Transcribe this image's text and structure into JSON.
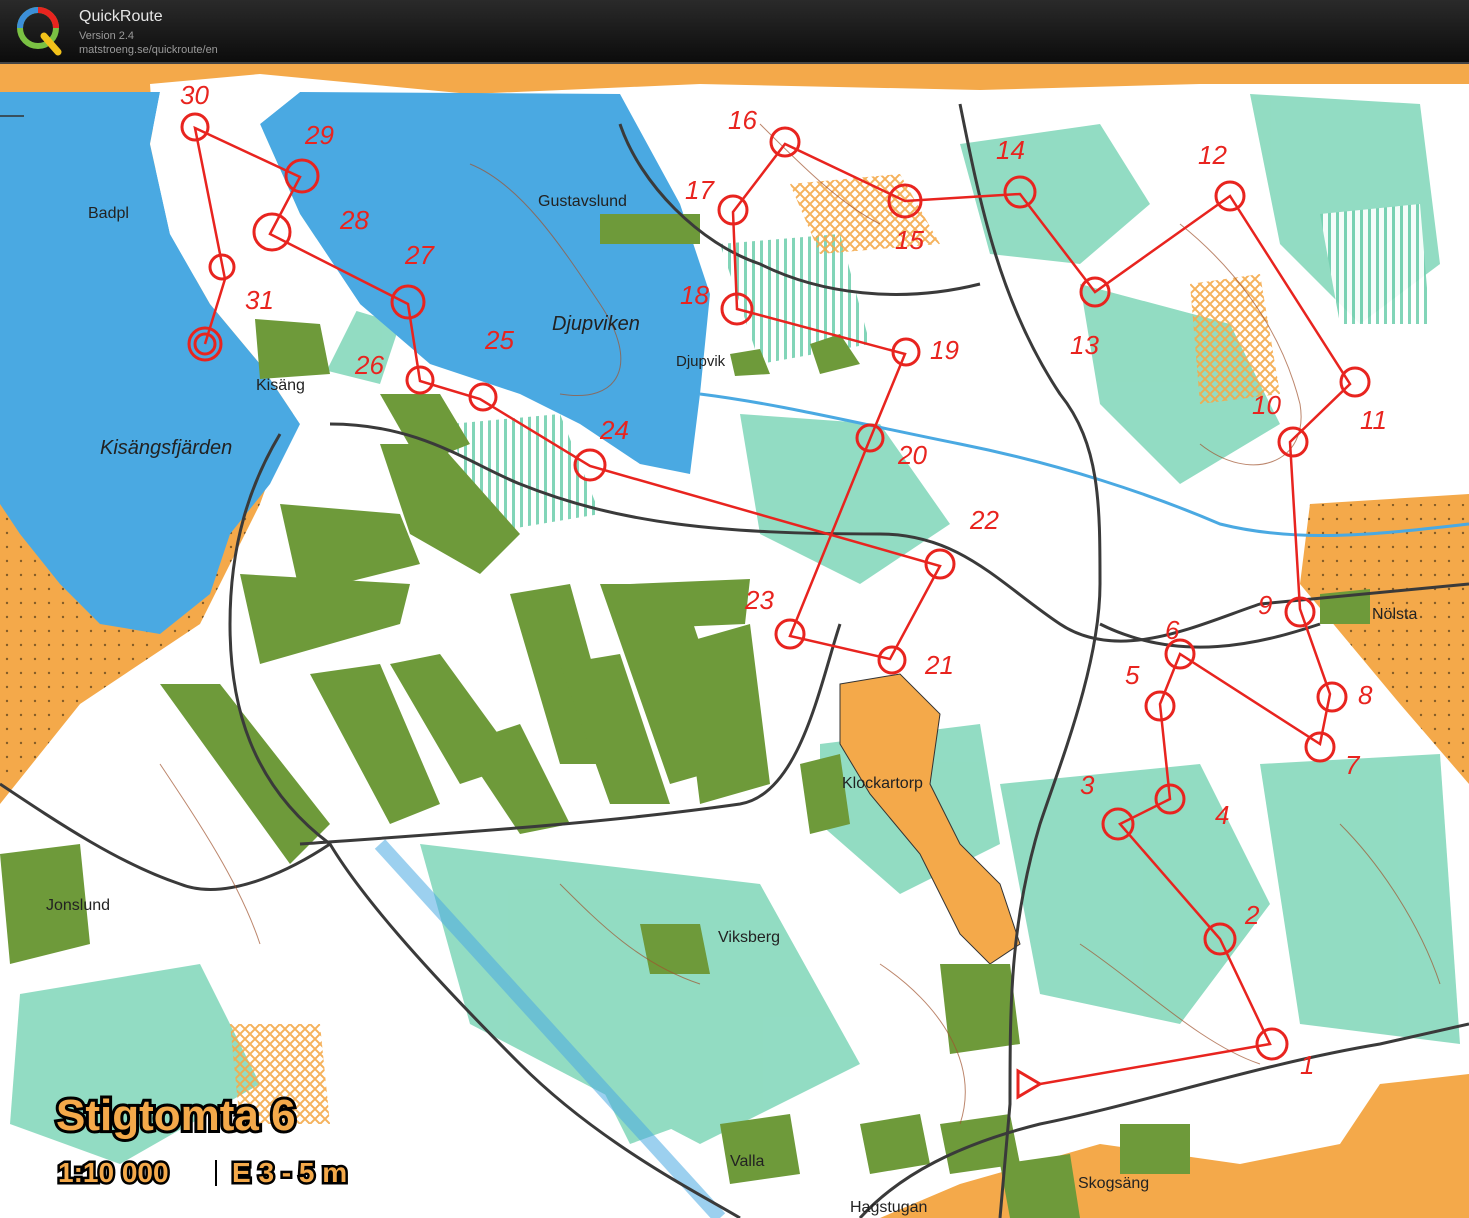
{
  "app": {
    "name": "QuickRoute",
    "version": "Version 2.4",
    "url": "matstroeng.se/quickroute/en"
  },
  "map": {
    "title": "Stigtomta 6",
    "scale": "1:10 000",
    "contour": "E 3 - 5 m",
    "places": {
      "badpl": "Badpl",
      "gustavslund": "Gustavslund",
      "djupviken": "Djupviken",
      "djupvik": "Djupvik",
      "kisang": "Kisäng",
      "kisangsfjarden": "Kisängsfjärden",
      "nolsta": "Nölsta",
      "klockartorp": "Klockartorp",
      "jonslund": "Jonslund",
      "viksberg": "Viksberg",
      "valla": "Valla",
      "hagstugan": "Hagstugan",
      "skogsang": "Skogsäng"
    },
    "control_numbers": {
      "c1": "1",
      "c2": "2",
      "c3": "3",
      "c4": "4",
      "c5": "5",
      "c6": "6",
      "c7": "7",
      "c8": "8",
      "c9": "9",
      "c10": "10",
      "c11": "11",
      "c12": "12",
      "c13": "13",
      "c14": "14",
      "c15": "15",
      "c16": "16",
      "c17": "17",
      "c18": "18",
      "c19": "19",
      "c20": "20",
      "c21": "21",
      "c22": "22",
      "c23": "23",
      "c24": "24",
      "c25": "25",
      "c26": "26",
      "c27": "27",
      "c28": "28",
      "c29": "29",
      "c30": "30",
      "c31": "31"
    },
    "colors": {
      "open_land": "#f4a94a",
      "forest": "#ffffff",
      "green": "#5ec8a2",
      "dark_green": "#6e9a3a",
      "water": "#4aa9e2",
      "course": "#e8241f"
    }
  }
}
